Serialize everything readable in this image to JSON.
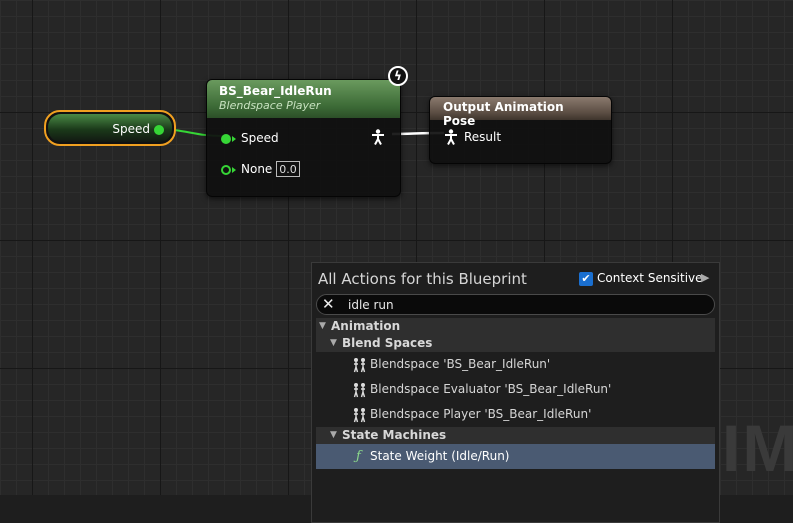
{
  "graph": {
    "watermark": "IMA",
    "variable_node": {
      "label": "Speed"
    },
    "blendspace_node": {
      "title": "BS_Bear_IdleRun",
      "subtitle": "Blendspace Player",
      "pins": {
        "speed_label": "Speed",
        "none_label": "None",
        "none_value": "0.0"
      }
    },
    "output_node": {
      "title": "Output Animation Pose",
      "result_label": "Result"
    }
  },
  "menu": {
    "title": "All Actions for this Blueprint",
    "context_sensitive_label": "Context Sensitive",
    "search": {
      "value": "idle run"
    },
    "tree": {
      "animation": "Animation",
      "blend_spaces": "Blend Spaces",
      "blend_items": [
        "Blendspace 'BS_Bear_IdleRun'",
        "Blendspace Evaluator 'BS_Bear_IdleRun'",
        "Blendspace Player 'BS_Bear_IdleRun'"
      ],
      "state_machines": "State Machines",
      "state_items": [
        "State Weight (Idle/Run)"
      ]
    }
  },
  "icons": {
    "exec": "lightning-icon",
    "pose": "pose-icon",
    "blend": "blendspace-icon",
    "function": "function-icon"
  },
  "colors": {
    "float_pin": "#36d636",
    "selected_outline": "#f0a020",
    "blendspace_header": "#3c6a36",
    "output_header": "#5a4c42",
    "selection": "#4a5a72",
    "check": "#1a6fd0"
  }
}
